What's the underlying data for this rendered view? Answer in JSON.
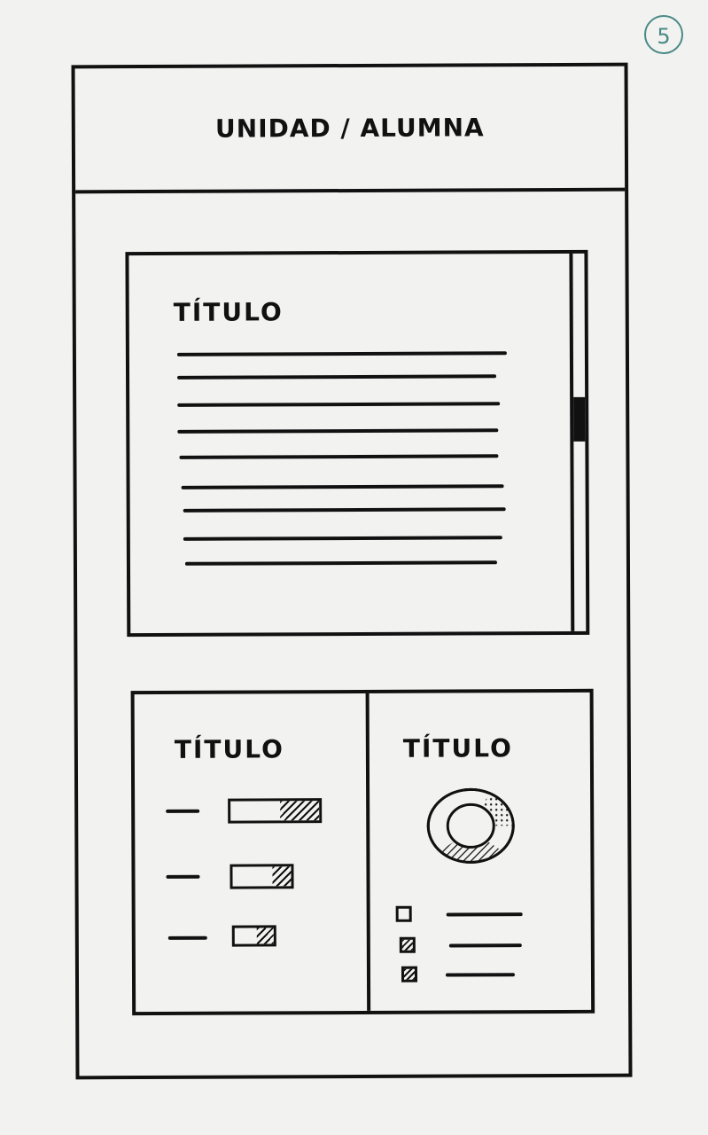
{
  "page_number": "5",
  "header": {
    "title": "UNIDAD / ALUMNA"
  },
  "main_card": {
    "title": "TÍTULO",
    "line_count": 9
  },
  "bottom_left_card": {
    "title": "TÍTULO",
    "bars": [
      {
        "progress": 0.44
      },
      {
        "progress": 0.32
      },
      {
        "progress": 0.44
      }
    ]
  },
  "bottom_right_card": {
    "title": "TÍTULO",
    "legend": [
      {
        "style": "empty"
      },
      {
        "style": "hatched"
      },
      {
        "style": "hatched"
      }
    ]
  }
}
